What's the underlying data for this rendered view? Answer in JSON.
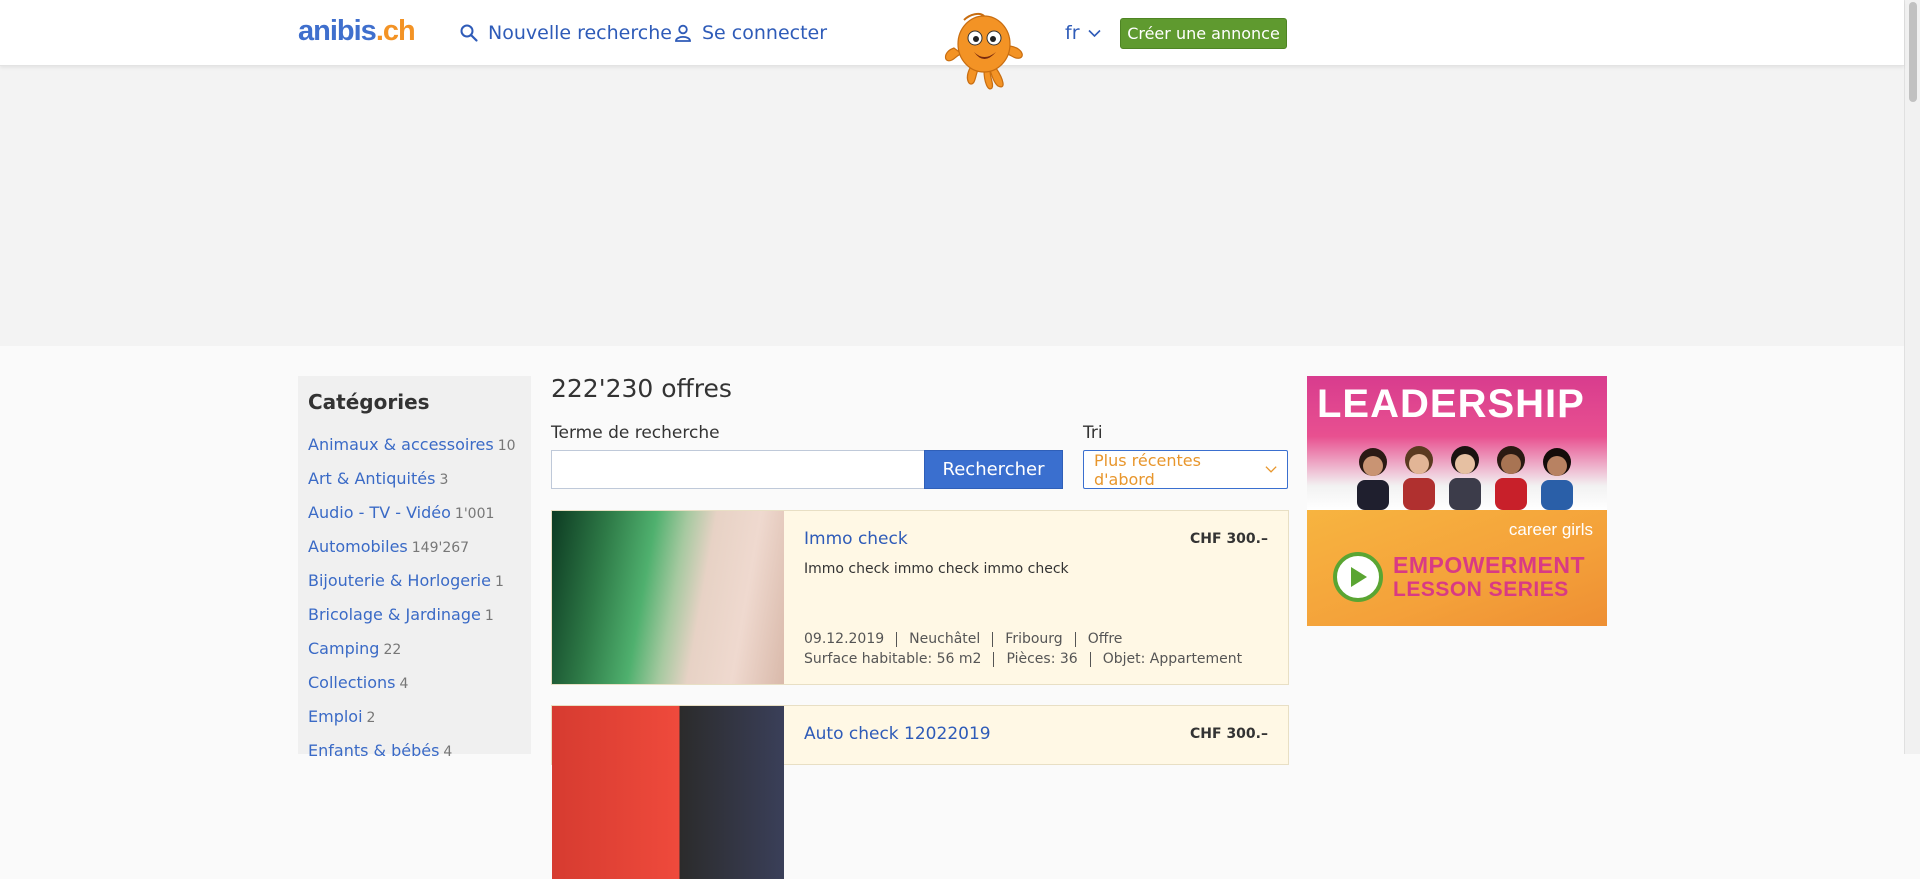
{
  "header": {
    "logo_part1": "anibis",
    "logo_part2": ".ch",
    "new_search": "Nouvelle recherche",
    "login": "Se connecter",
    "language": "fr",
    "create_ad": "Créer une annonce"
  },
  "sidebar": {
    "title": "Catégories",
    "items": [
      {
        "label": "Animaux & accessoires",
        "count": "10"
      },
      {
        "label": "Art & Antiquités",
        "count": "3"
      },
      {
        "label": "Audio - TV - Vidéo",
        "count": "1'001"
      },
      {
        "label": "Automobiles",
        "count": "149'267"
      },
      {
        "label": "Bijouterie & Horlogerie",
        "count": "1"
      },
      {
        "label": "Bricolage & Jardinage",
        "count": "1"
      },
      {
        "label": "Camping",
        "count": "22"
      },
      {
        "label": "Collections",
        "count": "4"
      },
      {
        "label": "Emploi",
        "count": "2"
      },
      {
        "label": "Enfants & bébés",
        "count": "4"
      }
    ]
  },
  "main": {
    "results_count": "222'230 offres",
    "search_label": "Terme de recherche",
    "search_value": "",
    "search_button": "Rechercher",
    "sort_label": "Tri",
    "sort_value": "Plus récentes d'abord"
  },
  "listings": [
    {
      "title": "Immo check",
      "price": "CHF 300.–",
      "description": "Immo check immo check immo check",
      "date": "09.12.2019",
      "location": "Neuchâtel",
      "region": "Fribourg",
      "type": "Offre",
      "surface": "Surface habitable: 56 m2",
      "rooms": "Pièces: 36",
      "object": "Objet: Appartement"
    },
    {
      "title": "Auto check 12022019",
      "price": "CHF 300.–"
    }
  ],
  "side_ad": {
    "heading": "LEADERSHIP",
    "brand": "career girls",
    "line1": "EMPOWERMENT",
    "line2": "LESSON SERIES"
  },
  "colors": {
    "brand_blue": "#3f6fcd",
    "brand_orange": "#f39325",
    "create_green": "#5f9a2f",
    "link_blue": "#2e5bb8",
    "card_bg": "#fff8e5"
  },
  "icons": [
    "search-icon",
    "user-icon",
    "chevron-down-icon",
    "mascot-octopus",
    "play-icon"
  ]
}
